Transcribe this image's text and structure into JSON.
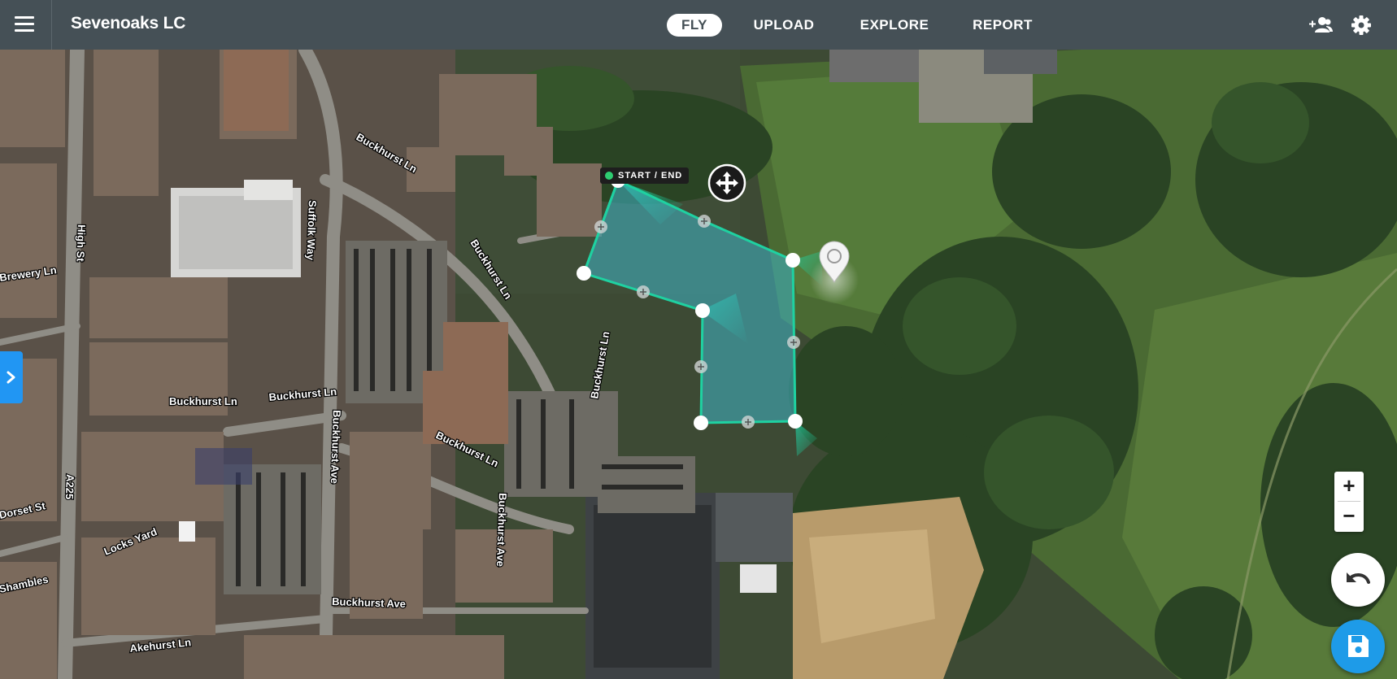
{
  "header": {
    "site_title": "Sevenoaks LC",
    "nav": [
      {
        "label": "FLY",
        "active": true
      },
      {
        "label": "UPLOAD",
        "active": false
      },
      {
        "label": "EXPLORE",
        "active": false
      },
      {
        "label": "REPORT",
        "active": false
      }
    ],
    "icons": {
      "menu": "hamburger-menu-icon",
      "users": "users-icon",
      "settings": "gear-icon"
    }
  },
  "map": {
    "street_labels": [
      "High St",
      "Suffolk Way",
      "Buckhurst Ln",
      "Buckhurst Ln",
      "Buckhurst Ln",
      "Buckhurst Ln",
      "Buckhurst Ln",
      "Buckhurst Ln",
      "Brewery Ln",
      "Dorset St",
      "A225",
      "Locks Yard",
      "Shambles",
      "Buckhurst Ave",
      "Buckhurst Ave",
      "Buckhurst Ave",
      "Akehurst Ln"
    ],
    "flight_plan": {
      "start_end_label": "START / END",
      "accent_color": "#1fd1a1",
      "fill_color": "#3fb7c9"
    }
  },
  "controls": {
    "zoom_in": "+",
    "zoom_out": "−",
    "side_panel_icon": "chevron-right-icon",
    "undo_icon": "undo-icon",
    "save_icon": "floppy-disk-save-icon",
    "move_icon": "move-arrows-icon",
    "location_pin_icon": "map-pin-icon"
  }
}
